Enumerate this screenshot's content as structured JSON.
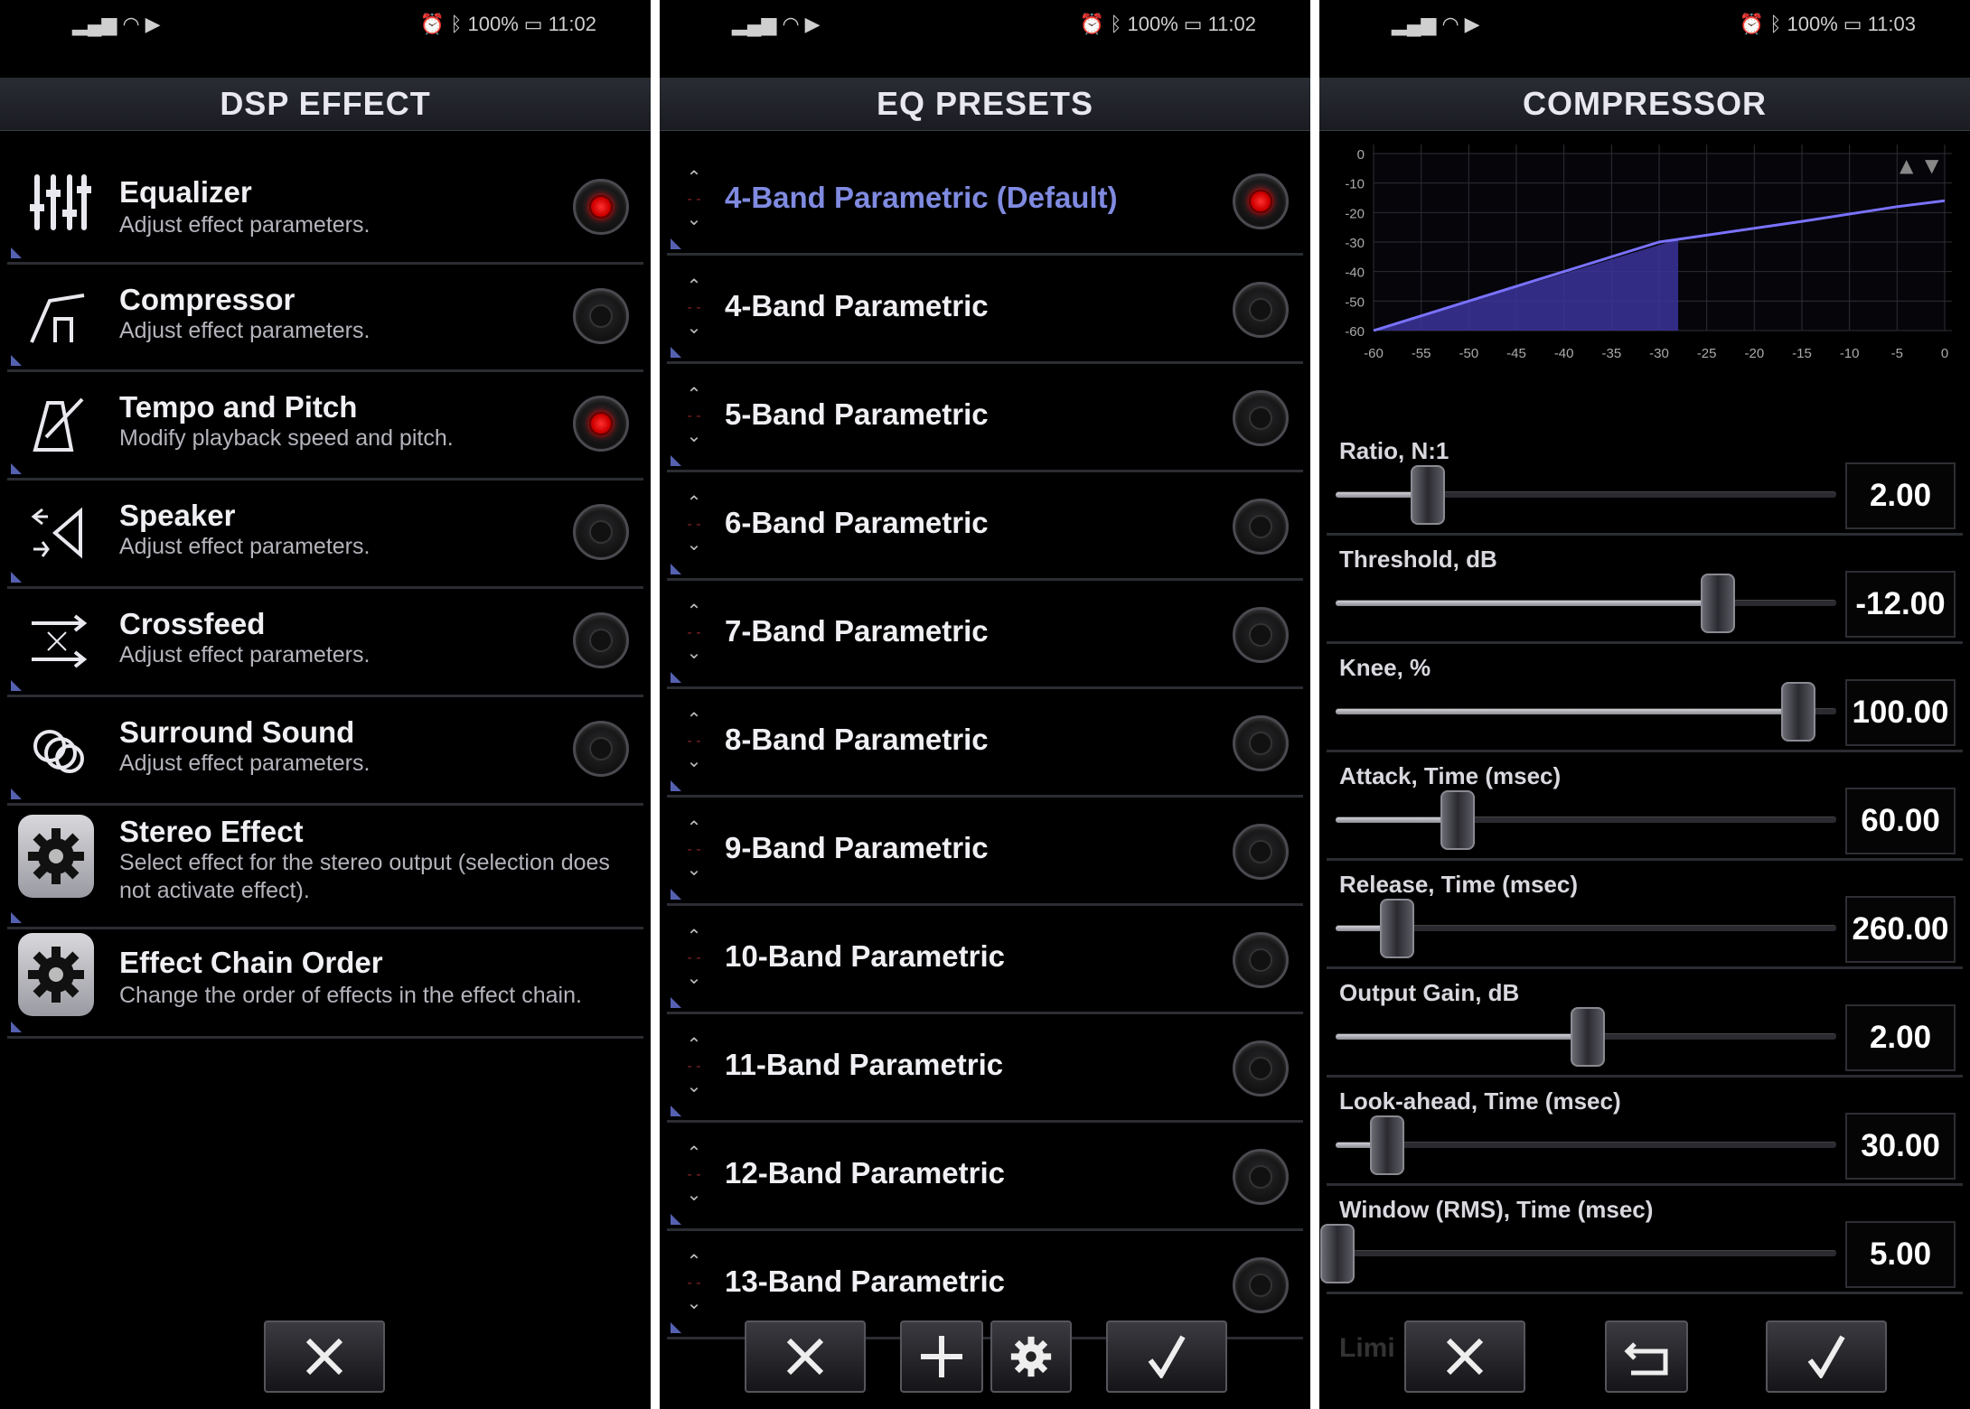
{
  "status_bars": [
    {
      "battery": "100%",
      "time": "11:02"
    },
    {
      "battery": "100%",
      "time": "11:02"
    },
    {
      "battery": "100%",
      "time": "11:03"
    }
  ],
  "dsp": {
    "title": "DSP EFFECT",
    "items": [
      {
        "title": "Equalizer",
        "subtitle": "Adjust effect parameters.",
        "active": true,
        "icon": "equalizer-sliders-icon"
      },
      {
        "title": "Compressor",
        "subtitle": "Adjust effect parameters.",
        "active": false,
        "icon": "compressor-curve-icon"
      },
      {
        "title": "Tempo and Pitch",
        "subtitle": "Modify playback speed and pitch.",
        "active": true,
        "icon": "metronome-icon"
      },
      {
        "title": "Speaker",
        "subtitle": "Adjust effect parameters.",
        "active": false,
        "icon": "speaker-icon"
      },
      {
        "title": "Crossfeed",
        "subtitle": "Adjust effect parameters.",
        "active": false,
        "icon": "crossfeed-arrows-icon"
      },
      {
        "title": "Surround Sound",
        "subtitle": "Adjust effect parameters.",
        "active": false,
        "icon": "surround-rings-icon"
      },
      {
        "title": "Stereo Effect",
        "subtitle": "Select effect for the stereo output (selection does not activate effect).",
        "icon": "gear-icon"
      },
      {
        "title": "Effect Chain Order",
        "subtitle": "Change the order of effects in the effect chain.",
        "icon": "gear-icon"
      }
    ],
    "close_icon": "close-icon"
  },
  "eq": {
    "title": "EQ PRESETS",
    "presets": [
      {
        "name": "4-Band Parametric (Default)",
        "selected": true
      },
      {
        "name": "4-Band Parametric",
        "selected": false
      },
      {
        "name": "5-Band Parametric",
        "selected": false
      },
      {
        "name": "6-Band Parametric",
        "selected": false
      },
      {
        "name": "7-Band Parametric",
        "selected": false
      },
      {
        "name": "8-Band Parametric",
        "selected": false
      },
      {
        "name": "9-Band Parametric",
        "selected": false
      },
      {
        "name": "10-Band Parametric",
        "selected": false
      },
      {
        "name": "11-Band Parametric",
        "selected": false
      },
      {
        "name": "12-Band Parametric",
        "selected": false
      },
      {
        "name": "13-Band Parametric",
        "selected": false
      }
    ]
  },
  "comp": {
    "title": "COMPRESSOR",
    "params": [
      {
        "label": "Ratio, N:1",
        "value": "2.00",
        "level": 0.18
      },
      {
        "label": "Threshold, dB",
        "value": "-12.00",
        "level": 0.76
      },
      {
        "label": "Knee, %",
        "value": "100.00",
        "level": 0.92
      },
      {
        "label": "Attack, Time (msec)",
        "value": "60.00",
        "level": 0.24
      },
      {
        "label": "Release, Time (msec)",
        "value": "260.00",
        "level": 0.12
      },
      {
        "label": "Output Gain, dB",
        "value": "2.00",
        "level": 0.5
      },
      {
        "label": "Look-ahead, Time (msec)",
        "value": "30.00",
        "level": 0.1
      },
      {
        "label": "Window (RMS), Time (msec)",
        "value": "5.00",
        "level": 0.0
      }
    ],
    "partial_label": "Limi",
    "chart_data": {
      "type": "line",
      "x_ticks": [
        "-60",
        "-55",
        "-50",
        "-45",
        "-40",
        "-35",
        "-30",
        "-25",
        "-20",
        "-15",
        "-10",
        "-5",
        "0"
      ],
      "y_ticks": [
        "0",
        "-10",
        "-20",
        "-30",
        "-40",
        "-50",
        "-60"
      ],
      "xlim": [
        -60,
        0
      ],
      "ylim": [
        -60,
        0
      ],
      "x": [
        -60,
        -30,
        -15,
        -5,
        0
      ],
      "y": [
        -60,
        -30,
        -23,
        -18,
        -16
      ],
      "shaded_range": [
        -60,
        -28
      ],
      "line_color": "#7a72ff"
    }
  }
}
